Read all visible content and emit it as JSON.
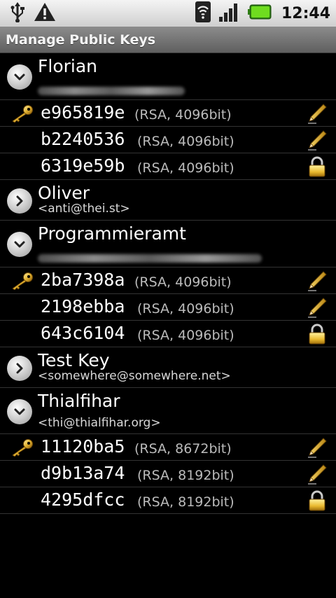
{
  "status_bar": {
    "time": "12:44",
    "icons": [
      "usb-icon",
      "warning-icon",
      "wifi-icon",
      "signal-icon",
      "battery-icon"
    ]
  },
  "title_bar": {
    "title": "Manage Public Keys"
  },
  "groups": [
    {
      "name": "Florian",
      "email": "",
      "email_obscured": true,
      "expanded": true,
      "keys": [
        {
          "id": "e965819e",
          "info": "(RSA, 4096bit)",
          "primary": true,
          "action_icon": "pencil-icon"
        },
        {
          "id": "b2240536",
          "info": "(RSA, 4096bit)",
          "primary": false,
          "action_icon": "pencil-icon"
        },
        {
          "id": "6319e59b",
          "info": "(RSA, 4096bit)",
          "primary": false,
          "action_icon": "lock-icon"
        }
      ]
    },
    {
      "name": "Oliver",
      "email": "<anti@thei.st>",
      "email_obscured": false,
      "expanded": false,
      "keys": []
    },
    {
      "name": "Programmieramt",
      "email": "",
      "email_obscured": true,
      "expanded": true,
      "keys": [
        {
          "id": "2ba7398a",
          "info": "(RSA, 4096bit)",
          "primary": true,
          "action_icon": "pencil-icon"
        },
        {
          "id": "2198ebba",
          "info": "(RSA, 4096bit)",
          "primary": false,
          "action_icon": "pencil-icon"
        },
        {
          "id": "643c6104",
          "info": "(RSA, 4096bit)",
          "primary": false,
          "action_icon": "lock-icon"
        }
      ]
    },
    {
      "name": "Test Key",
      "email": "<somewhere@somewhere.net>",
      "email_obscured": false,
      "expanded": false,
      "keys": []
    },
    {
      "name": "Thialfihar",
      "email": "<thi@thialfihar.org>",
      "email_obscured": false,
      "expanded": true,
      "keys": [
        {
          "id": "11120ba5",
          "info": "(RSA, 8672bit)",
          "primary": true,
          "action_icon": "pencil-icon"
        },
        {
          "id": "d9b13a74",
          "info": "(RSA, 8192bit)",
          "primary": false,
          "action_icon": "pencil-icon"
        },
        {
          "id": "4295dfcc",
          "info": "(RSA, 8192bit)",
          "primary": false,
          "action_icon": "lock-icon"
        }
      ]
    }
  ]
}
